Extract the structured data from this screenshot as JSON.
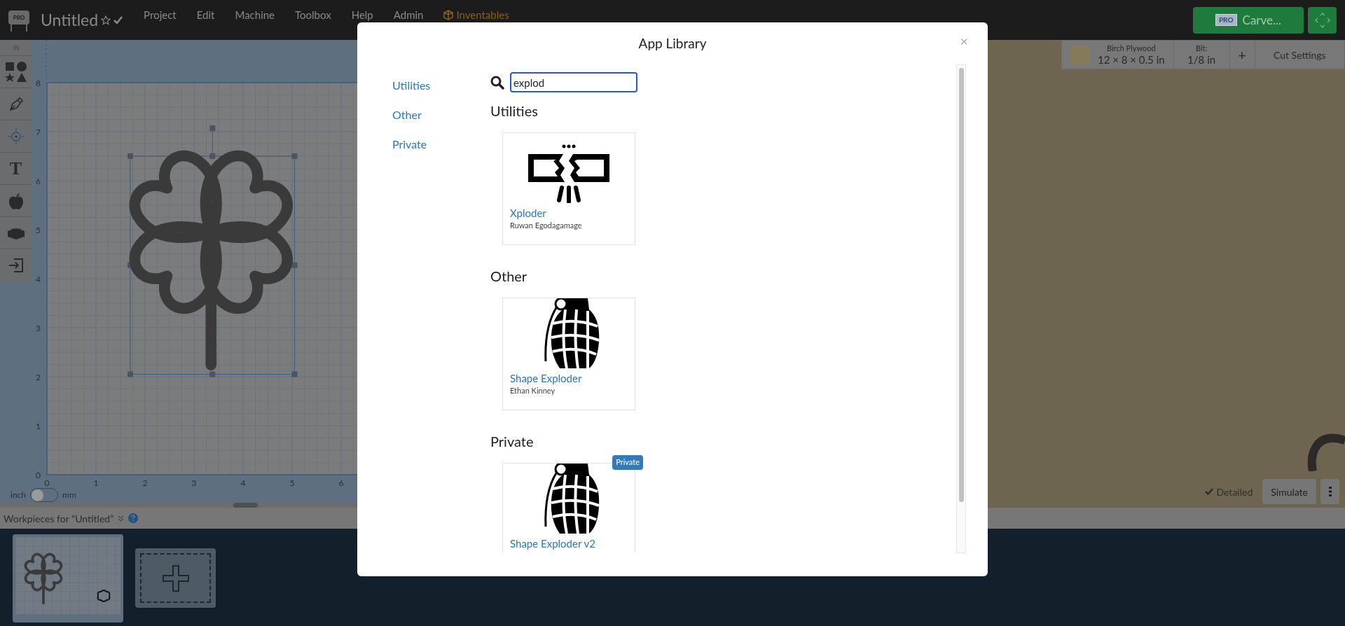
{
  "topbar": {
    "logo_badge": "PRO",
    "title": "Untitled",
    "menu": [
      {
        "label": "Project",
        "kind": "plain"
      },
      {
        "label": "Edit",
        "kind": "plain"
      },
      {
        "label": "Machine",
        "kind": "plain"
      },
      {
        "label": "Toolbox",
        "kind": "plain"
      },
      {
        "label": "Help",
        "kind": "plain"
      },
      {
        "label": "Admin",
        "kind": "plain"
      },
      {
        "label": "Inventables",
        "kind": "brand"
      }
    ],
    "carve": {
      "badge": "PRO",
      "label": "Carve..."
    }
  },
  "tools": {
    "text_glyph": "T"
  },
  "canvas": {
    "y_ticks": [
      "8",
      "7",
      "6",
      "5",
      "4",
      "3",
      "2",
      "1",
      "0"
    ],
    "x_ticks": [
      "0",
      "1",
      "2",
      "3",
      "4",
      "5",
      "6"
    ],
    "units": {
      "left": "inch",
      "right": "mm",
      "on": false
    }
  },
  "material": {
    "name": "Birch Plywood",
    "size": "12 × 8 × 0.5 in",
    "bit_label": "Bit:",
    "bit_value": "1/8 in",
    "add": "+",
    "cut_settings": "Cut Settings"
  },
  "preview": {
    "detailed": "Detailed",
    "simulate": "Simulate"
  },
  "workpieces": {
    "title": "Workpieces for “Untitled”"
  },
  "modal": {
    "title": "App Library",
    "close": "×",
    "nav": [
      "Utilities",
      "Other",
      "Private"
    ],
    "search": {
      "value": "explod"
    },
    "sections": [
      {
        "heading": "Utilities",
        "apps": [
          {
            "name": "Xploder",
            "author": "Ruwan Egodagamage",
            "kind": "broken-frame"
          }
        ]
      },
      {
        "heading": "Other",
        "apps": [
          {
            "name": "Shape Exploder",
            "author": "Ethan Kinney",
            "kind": "grenade"
          }
        ]
      },
      {
        "heading": "Private",
        "apps": [
          {
            "name": "Shape Exploder v2",
            "badge": "Private",
            "kind": "grenade"
          }
        ]
      }
    ]
  }
}
